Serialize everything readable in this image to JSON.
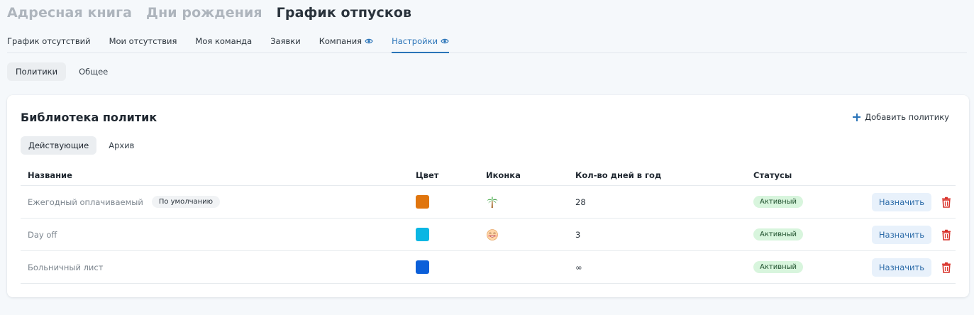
{
  "app_tabs": [
    {
      "label": "Адресная книга"
    },
    {
      "label": "Дни рождения"
    },
    {
      "label": "График отпусков"
    }
  ],
  "nav_tabs": [
    {
      "label": "График отсутствий"
    },
    {
      "label": "Мои отсутствия"
    },
    {
      "label": "Моя команда"
    },
    {
      "label": "Заявки"
    },
    {
      "label": "Компания",
      "icon": "eye-icon"
    },
    {
      "label": "Настройки",
      "icon": "eye-icon"
    }
  ],
  "settings_tabs": [
    {
      "label": "Политики"
    },
    {
      "label": "Общее"
    }
  ],
  "library": {
    "title": "Библиотека политик",
    "add_label": "Добавить политику",
    "subtabs": [
      {
        "label": "Действующие"
      },
      {
        "label": "Архив"
      }
    ],
    "columns": {
      "name": "Название",
      "color": "Цвет",
      "icon": "Иконка",
      "days": "Кол-во дней в год",
      "status": "Статусы"
    },
    "rows": [
      {
        "name": "Ежегодный оплачиваемый",
        "badge": "По умолчанию",
        "color": "#e0750e",
        "icon": "palm-tree-icon",
        "days": "28",
        "status": "Активный",
        "assign": "Назначить"
      },
      {
        "name": "Day off",
        "color": "#0bb6e3",
        "icon": "smiley-face-icon",
        "days": "3",
        "status": "Активный",
        "assign": "Назначить"
      },
      {
        "name": "Больничный лист",
        "color": "#0b5fd9",
        "days": "∞",
        "status": "Активный",
        "assign": "Назначить"
      }
    ]
  },
  "colors": {
    "accent": "#2a74b8",
    "delete": "#d9332b"
  }
}
